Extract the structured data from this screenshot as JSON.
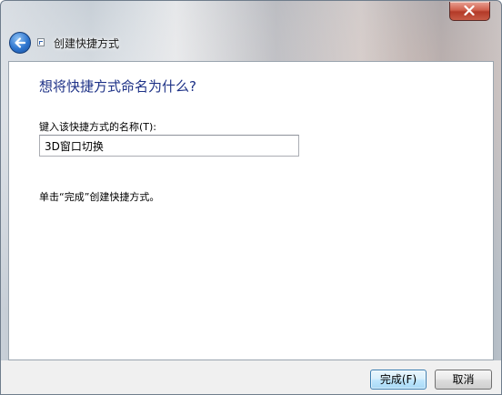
{
  "window": {
    "title": "创建快捷方式",
    "close_icon": "close-icon",
    "back_icon": "back-arrow-icon",
    "app_icon": "shortcut-icon"
  },
  "main": {
    "heading": "想将快捷方式命名为什么?",
    "name_label": "键入该快捷方式的名称(T):",
    "name_value": "3D窗口切换",
    "hint": "单击“完成”创建快捷方式。"
  },
  "footer": {
    "finish_label": "完成(F)",
    "cancel_label": "取消"
  },
  "colors": {
    "heading": "#1e3287",
    "close_button": "#c75a45",
    "back_button": "#2f76cf"
  }
}
